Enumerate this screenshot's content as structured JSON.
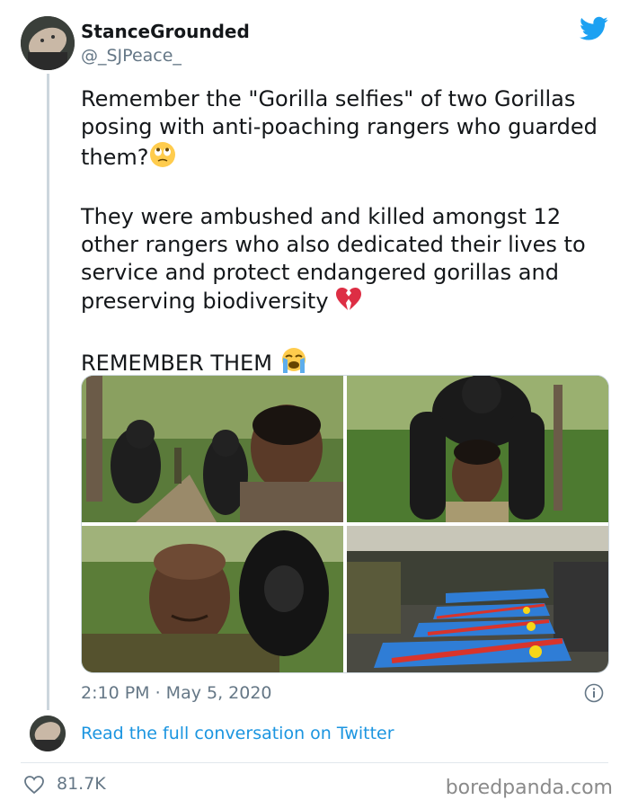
{
  "user": {
    "display_name": "StanceGrounded",
    "handle": "@_SJPeace_"
  },
  "icons": {
    "brand": "twitter-bird-icon",
    "info": "info-icon",
    "like": "heart-outline-icon",
    "eye_roll_emoji": "face-with-rolling-eyes-emoji",
    "broken_heart_emoji": "broken-heart-emoji",
    "crying_emoji": "loudly-crying-face-emoji"
  },
  "tweet": {
    "paragraph1": "Remember the \"Gorilla selfies\" of two Gorillas posing with anti-poaching rangers who guarded them?",
    "paragraph2": "They were ambushed and killed amongst 12 other rangers who also dedicated their lives to service and protect endangered gorillas and preserving biodiversity",
    "paragraph3": "REMEMBER THEM",
    "timestamp": "2:10 PM · May 5, 2020"
  },
  "footer": {
    "read_link": "Read the full conversation on Twitter",
    "like_count": "81.7K"
  },
  "watermark": "boredpanda.com",
  "colors": {
    "accent": "#1b95e0",
    "text": "#14171a",
    "muted": "#657786"
  }
}
